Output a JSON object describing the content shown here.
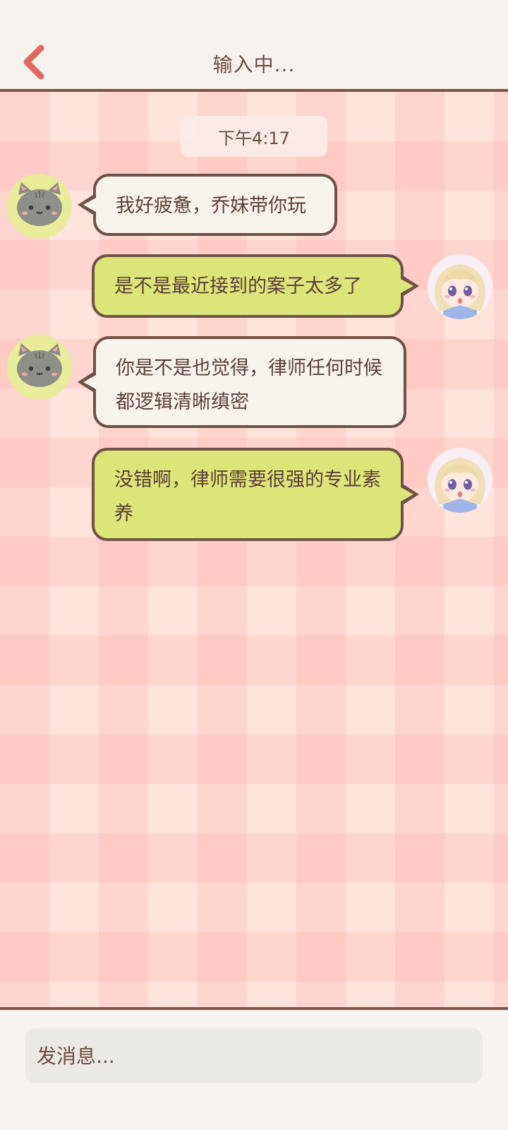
{
  "header": {
    "title": "输入中..."
  },
  "chat": {
    "time": "下午4:17",
    "messages": [
      {
        "side": "left",
        "text": "我好疲惫，乔妹带你玩"
      },
      {
        "side": "right",
        "text": "是不是最近接到的案子太多了"
      },
      {
        "side": "left",
        "text": "你是不是也觉得，律师任何时候都逻辑清晰缜密"
      },
      {
        "side": "right",
        "text": "没错啊，律师需要很强的专业素养"
      }
    ]
  },
  "input": {
    "placeholder": "发消息..."
  },
  "colors": {
    "header_bg": "#f6f3ee",
    "accent_back": "#e06a62",
    "text": "#6e4c40",
    "bubble_left": "#f7f4ee",
    "bubble_right": "#dbe57a",
    "border": "#6f5147"
  },
  "icons": {
    "back": "chevron-left-icon",
    "cat_avatar": "cat-avatar",
    "girl_avatar": "anime-girl-avatar"
  }
}
